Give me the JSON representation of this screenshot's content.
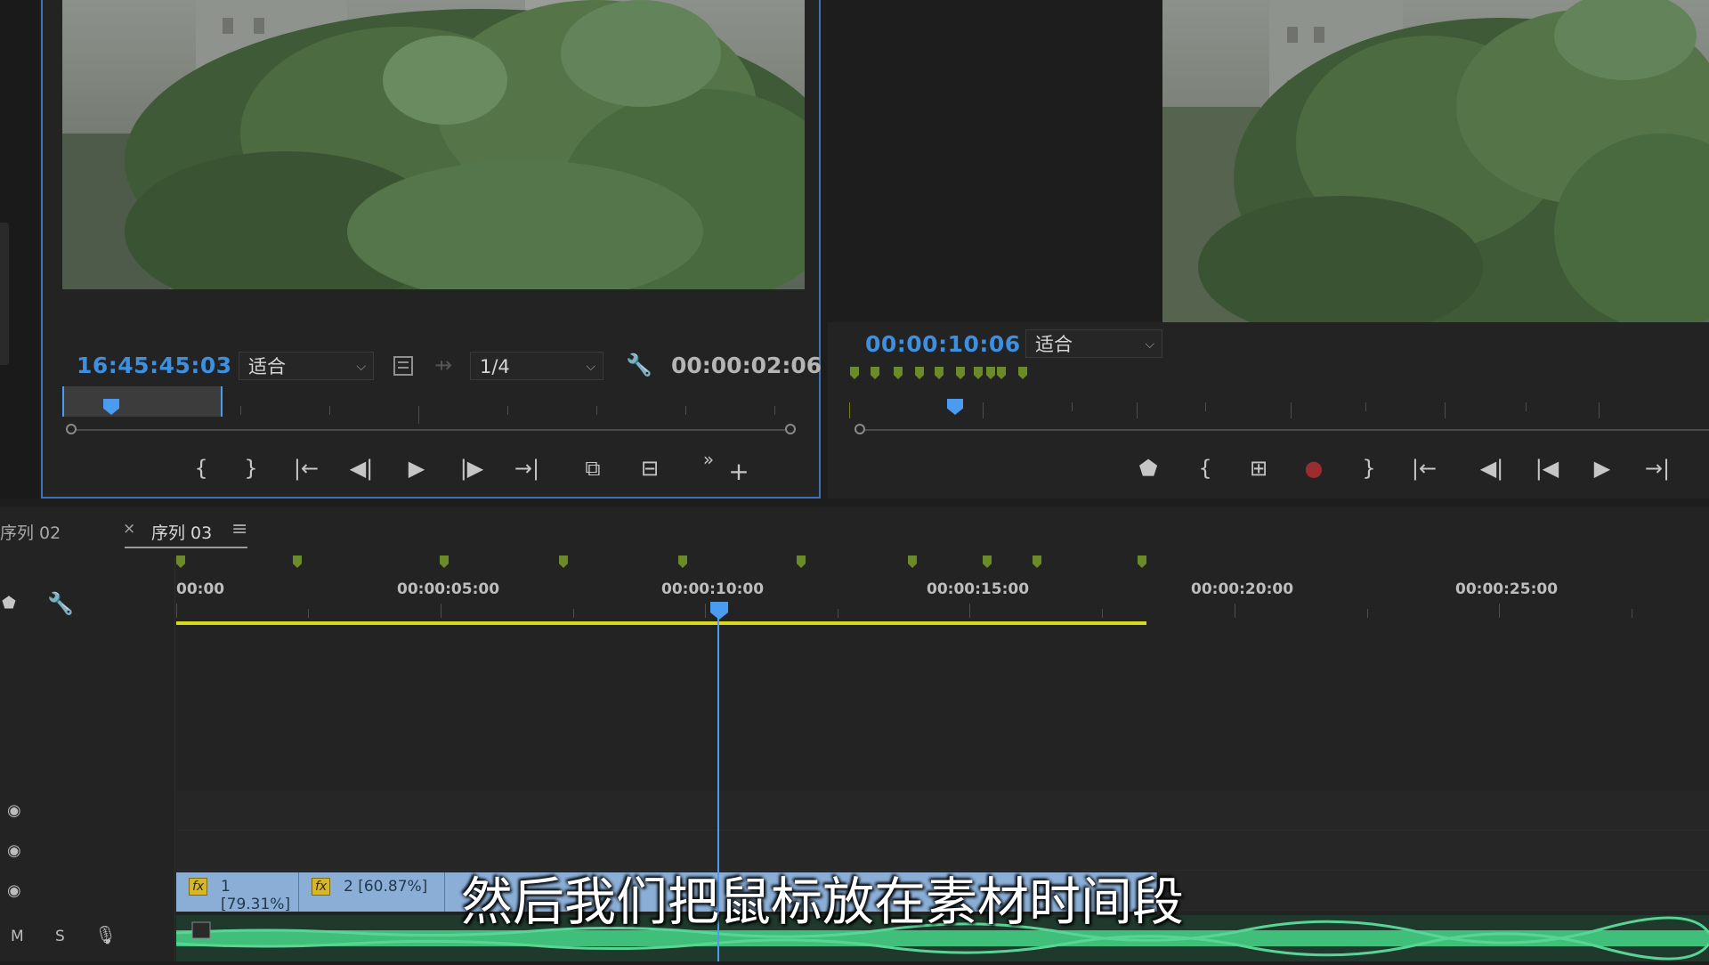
{
  "source_monitor": {
    "timecode": "16:45:45:03",
    "fit_label": "适合",
    "resolution_label": "1/4",
    "duration": "00:00:02:06"
  },
  "program_monitor": {
    "timecode": "00:00:10:06",
    "fit_label": "适合"
  },
  "timeline": {
    "tabs": [
      {
        "label": "序列 02"
      },
      {
        "label": "序列 03"
      }
    ],
    "close_glyph": "×",
    "menu_glyph": "≡",
    "ruler_labels": [
      "00:00",
      "00:00:05:00",
      "00:00:10:00",
      "00:00:15:00",
      "00:00:20:00",
      "00:00:25:00"
    ],
    "clips": [
      {
        "label": "1 [79.31%]"
      },
      {
        "label": "2 [60.87%]"
      }
    ],
    "audio_header": {
      "m": "M",
      "s": "S"
    }
  },
  "subtitle": "然后我们把鼠标放在素材时间段",
  "colors": {
    "accent_blue": "#3d8fe0",
    "playhead": "#4b9bf0",
    "marker_green": "#6b8a2a",
    "work_area": "#d8d81c",
    "clip_blue": "#8aaed6",
    "audio_green": "#3fbf7a"
  }
}
